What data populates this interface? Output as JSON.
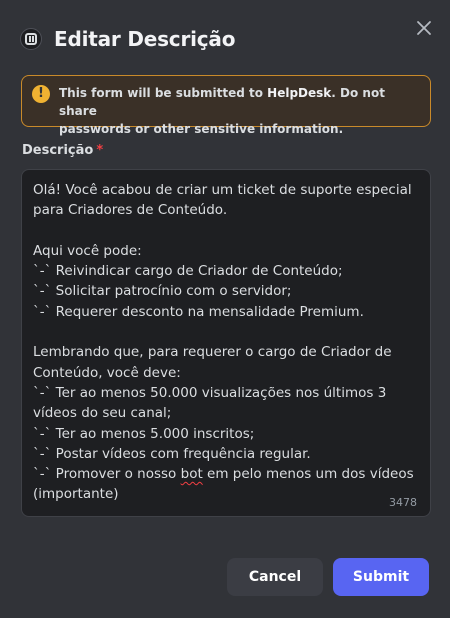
{
  "modal": {
    "title": "Editar Descrição",
    "app_icon": "server-app-icon",
    "close_icon": "close-icon"
  },
  "notice": {
    "icon": "warning-icon",
    "icon_glyph": "!",
    "text_before": "This form will be submitted to ",
    "text_brand": "HelpDesk",
    "text_after_line1": ". Do not share",
    "text_line2": "passwords or other sensitive information."
  },
  "field": {
    "label": "Descrição",
    "required_mark": "*",
    "lines": [
      "Olá! Você acabou de criar um ticket de suporte especial",
      "para Criadores de Conteúdo.",
      "",
      "Aqui você pode:",
      "`-` Reivindicar cargo de Criador de Conteúdo;",
      "`-` Solicitar patrocínio com o servidor;",
      "`-` Requerer desconto na mensalidade Premium.",
      "",
      "Lembrando que, para requerer o cargo de Criador de",
      "Conteúdo, você deve:",
      "`-` Ter ao menos 50.000 visualizações nos últimos 3",
      "vídeos do seu canal;",
      "`-` Ter ao menos 5.000 inscritos;",
      "`-` Postar vídeos com frequência regular.",
      "`-` Promover o nosso bot em pelo menos um dos vídeos",
      "(importante)"
    ],
    "char_count": "3478"
  },
  "buttons": {
    "cancel": "Cancel",
    "submit": "Submit"
  },
  "colors": {
    "background": "#313338",
    "accent": "#5865f2",
    "warning": "#f0b232",
    "required": "#f23f43"
  }
}
